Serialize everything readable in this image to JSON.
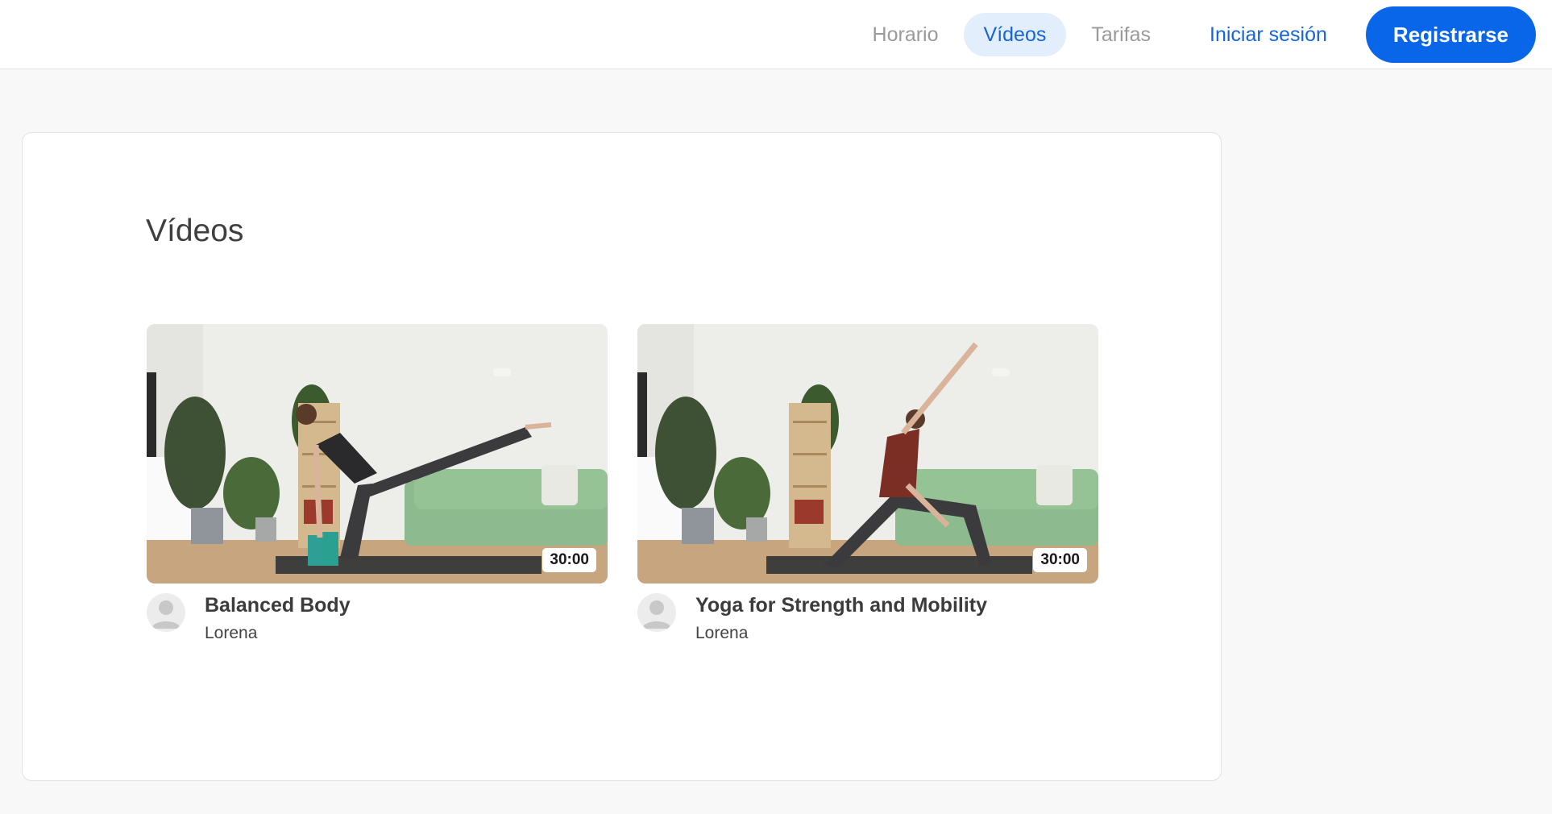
{
  "nav": {
    "items": [
      {
        "label": "Horario",
        "active": false
      },
      {
        "label": "Vídeos",
        "active": true
      },
      {
        "label": "Tarifas",
        "active": false
      }
    ],
    "login_label": "Iniciar sesión",
    "register_label": "Registrarse"
  },
  "page": {
    "title": "Vídeos"
  },
  "videos": [
    {
      "title": "Balanced Body",
      "author": "Lorena",
      "duration": "30:00",
      "thumbnail_icon": "yoga-warrior-three-photo"
    },
    {
      "title": "Yoga for Strength and Mobility",
      "author": "Lorena",
      "duration": "30:00",
      "thumbnail_icon": "yoga-reverse-warrior-photo"
    }
  ],
  "colors": {
    "accent": "#0a66e8",
    "accent_light": "#e3eefc",
    "background": "#f8f8f8"
  }
}
